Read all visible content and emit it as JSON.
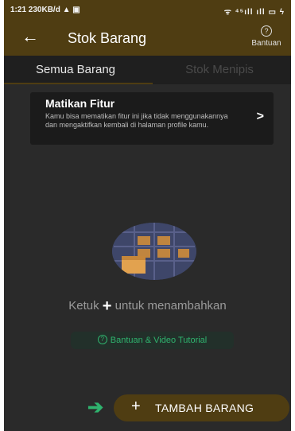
{
  "status_bar": {
    "time": "1:21",
    "speed": "230KB/d",
    "icons_text": "ᯤ ⁴⁵ıll ıll ▭ ϟ"
  },
  "appbar": {
    "back_glyph": "←",
    "title": "Stok Barang",
    "help_glyph": "?",
    "help_label": "Bantuan"
  },
  "tabs": [
    {
      "label": "Semua Barang",
      "active": true
    },
    {
      "label": "Stok Menipis",
      "active": false
    }
  ],
  "feature_card": {
    "title": "Matikan Fitur",
    "description": "Kamu bisa mematikan fitur ini jika tidak menggunakannya dan mengaktifkan kembali di halaman profile kamu.",
    "arrow": ">"
  },
  "empty_state": {
    "text_before": "Ketuk",
    "plus_glyph": "+",
    "text_after": "untuk menambahkan",
    "tutorial_glyph": "?",
    "tutorial_label": "Bantuan & Video Tutorial"
  },
  "fab": {
    "arrow_glyph": "➔",
    "plus_glyph": "+",
    "label": "TAMBAH BARANG"
  },
  "colors": {
    "brand_brown": "#4f3d12",
    "accent_green": "#2fb36e",
    "background": "#2a2a2a"
  }
}
